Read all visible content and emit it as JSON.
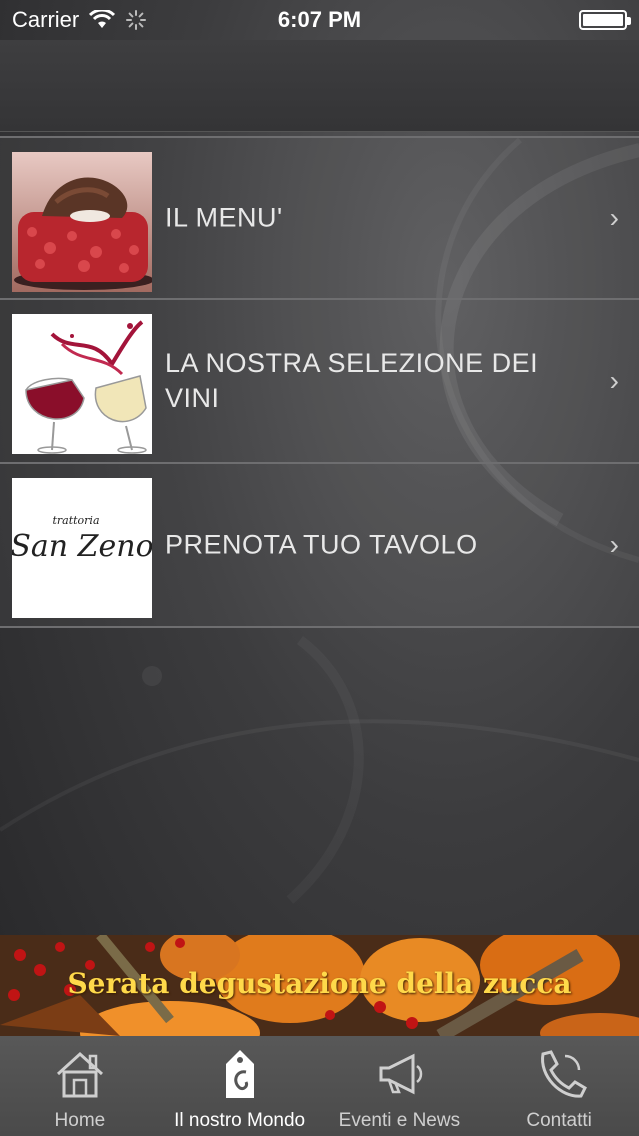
{
  "status_bar": {
    "carrier": "Carrier",
    "time": "6:07 PM"
  },
  "menu": {
    "items": [
      {
        "label": "IL MENU'",
        "icon": "dessert-photo"
      },
      {
        "label": "LA NOSTRA SELEZIONE DEI VINI",
        "icon": "wine-glasses-photo"
      },
      {
        "label": "PRENOTA TUO TAVOLO",
        "icon": "trattoria-san-zeno-logo"
      }
    ],
    "chevron": "›"
  },
  "logo": {
    "small_text": "trattoria",
    "big_text": "San Zeno"
  },
  "banner": {
    "text": "Serata degustazione della zucca"
  },
  "tab_bar": {
    "tabs": [
      {
        "label": "Home",
        "icon": "house-icon",
        "active": false
      },
      {
        "label": "Il nostro Mondo",
        "icon": "tag-icon",
        "active": true
      },
      {
        "label": "Eventi e News",
        "icon": "megaphone-icon",
        "active": false
      },
      {
        "label": "Contatti",
        "icon": "phone-icon",
        "active": false
      }
    ]
  },
  "colors": {
    "background": "#3c3c3e",
    "banner_text": "#ffd94a",
    "tab_bar": "#4f4f4f"
  }
}
